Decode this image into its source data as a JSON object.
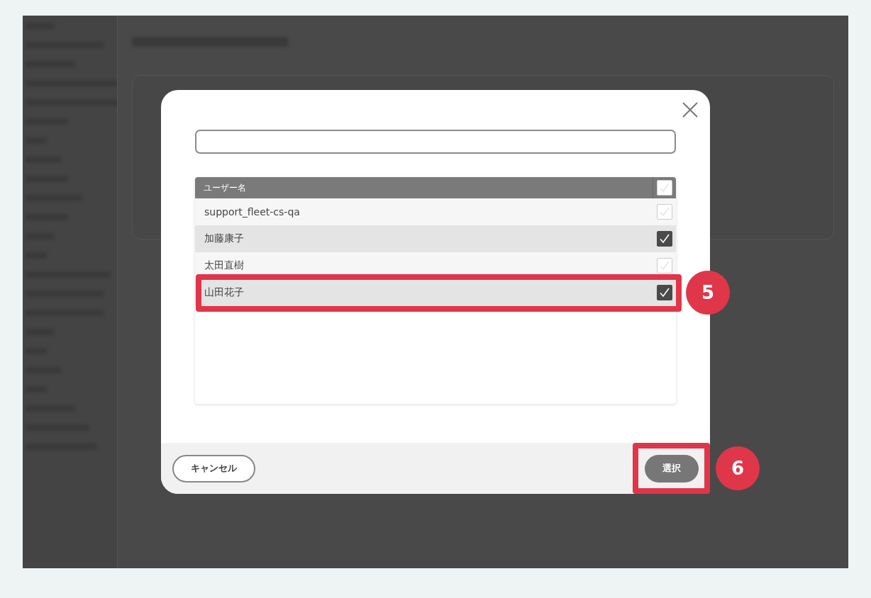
{
  "dialog": {
    "table": {
      "header": {
        "label": "ユーザー名",
        "checked": false
      },
      "rows": [
        {
          "name": "support_fleet-cs-qa",
          "checked": false,
          "highlighted": false
        },
        {
          "name": "加藤康子",
          "checked": true,
          "highlighted": false
        },
        {
          "name": "太田直樹",
          "checked": false,
          "highlighted": false
        },
        {
          "name": "山田花子",
          "checked": true,
          "highlighted": true,
          "callout": "5"
        }
      ]
    },
    "buttons": [
      {
        "label": "キャンセル",
        "kind": "secondary",
        "highlighted": false
      },
      {
        "label": "選択",
        "kind": "primary",
        "highlighted": true,
        "callout": "6"
      }
    ]
  }
}
